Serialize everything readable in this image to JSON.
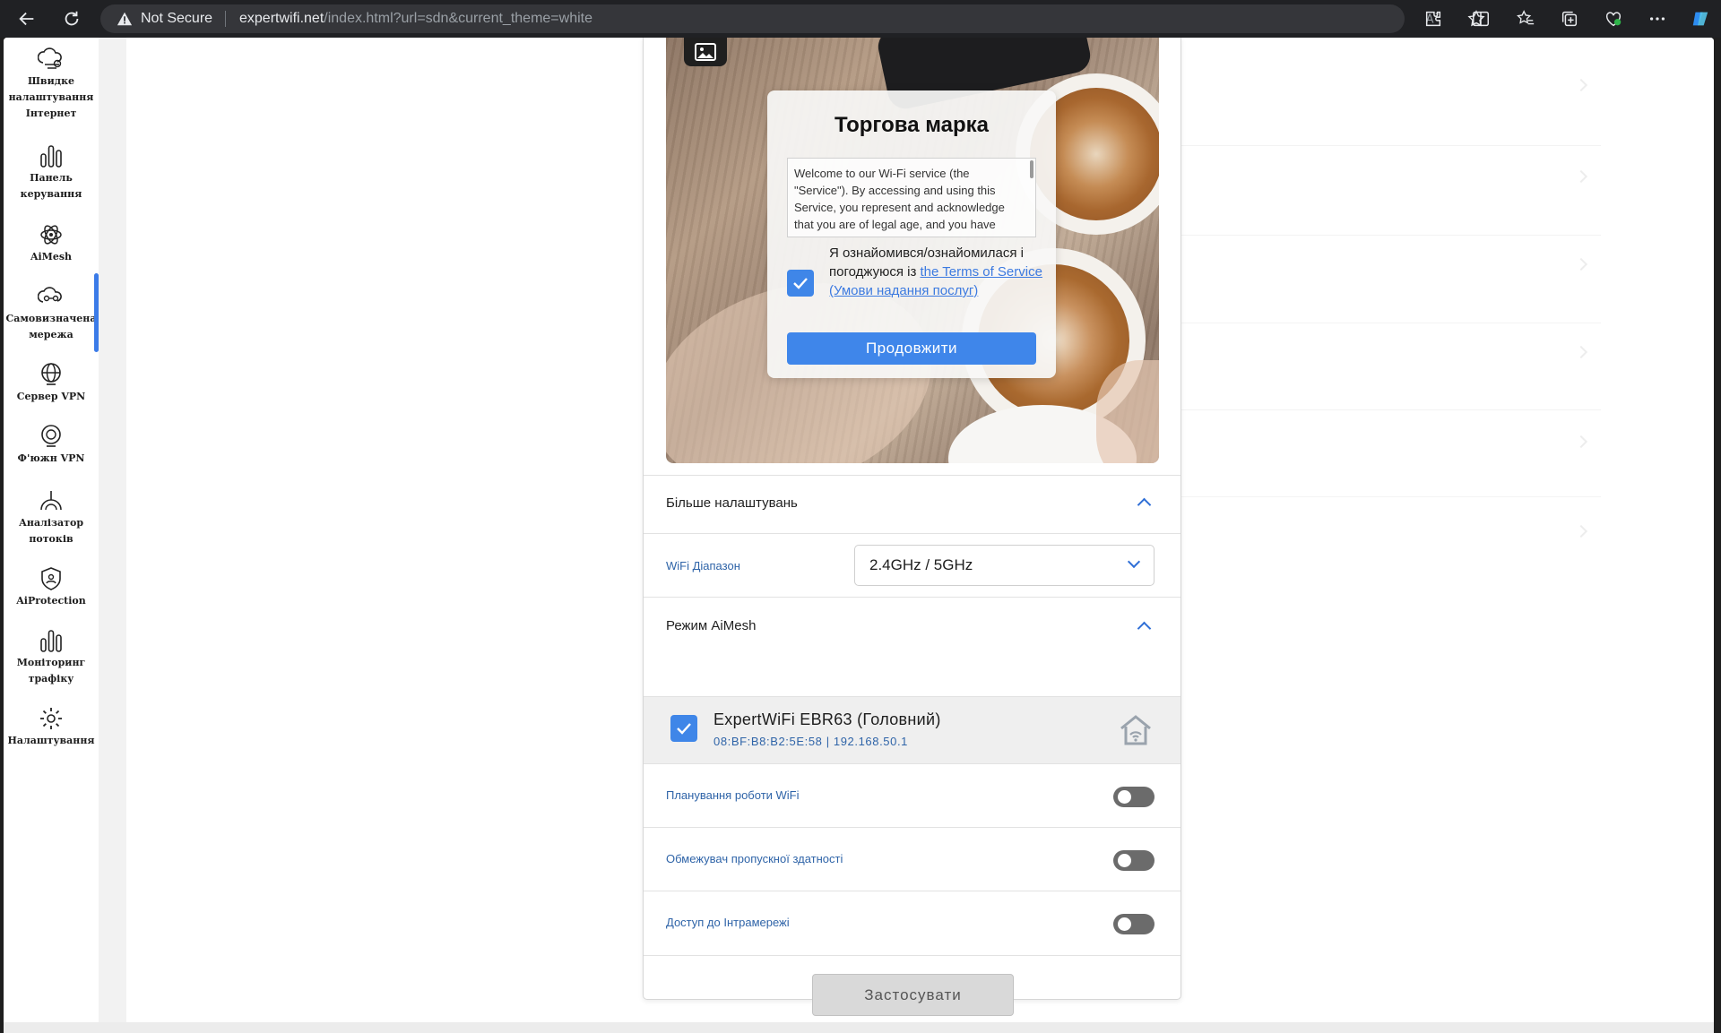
{
  "browser": {
    "security_status": "Not Secure",
    "url_host": "expertwifi.net",
    "url_path": "/index.html?url=sdn&current_theme=white"
  },
  "sidebar": {
    "items": [
      {
        "label": "Швидке налаштування Інтернет",
        "icon": "quick-setup-icon"
      },
      {
        "label": "Панель керування",
        "icon": "dashboard-icon"
      },
      {
        "label": "AiMesh",
        "icon": "aimesh-icon"
      },
      {
        "label": "Самовизначена мережа",
        "icon": "sdn-icon"
      },
      {
        "label": "Сервер VPN",
        "icon": "vpn-server-icon"
      },
      {
        "label": "Ф'южн VPN",
        "icon": "vpn-fusion-icon"
      },
      {
        "label": "Аналізатор потоків",
        "icon": "traffic-analyzer-icon"
      },
      {
        "label": "AiProtection",
        "icon": "aiprotection-icon"
      },
      {
        "label": "Моніторинг трафіку",
        "icon": "traffic-monitor-icon"
      },
      {
        "label": "Налаштування",
        "icon": "settings-icon"
      }
    ],
    "active_index": 3,
    "accent_color": "#3b7be8"
  },
  "portal": {
    "title": "Торгова марка",
    "tos_text": "Welcome to our Wi-Fi service (the \"Service\"). By accessing and using this Service, you represent and acknowledge that you are of legal age, and you have",
    "agree_prefix": "Я ознайомився/ознайомилася і погоджуюся із ",
    "agree_link": "the Terms of Service (Умови надання послуг)",
    "agree_checked": true,
    "continue_label": "Продовжити"
  },
  "settings": {
    "more_settings_label": "Більше налаштувань",
    "wifi_band_label": "WiFi Діапазон",
    "wifi_band_value": "2.4GHz / 5GHz",
    "aimesh_mode_label": "Режим AiMesh",
    "node": {
      "name": "ExpertWiFi EBR63 (Головний)",
      "meta": "08:BF:B8:B2:5E:58 | 192.168.50.1",
      "checked": true
    },
    "wifi_schedule_label": "Планування роботи WiFi",
    "wifi_schedule_on": false,
    "bandwidth_limiter_label": "Обмежувач пропускної здатності",
    "bandwidth_limiter_on": false,
    "intranet_access_label": "Доступ до Інтрамережі",
    "intranet_access_on": false,
    "apply_label": "Застосувати"
  },
  "colors": {
    "primary_blue": "#3f86ea",
    "label_blue": "#2f64a8",
    "toggle_off": "#6b6b6b"
  }
}
